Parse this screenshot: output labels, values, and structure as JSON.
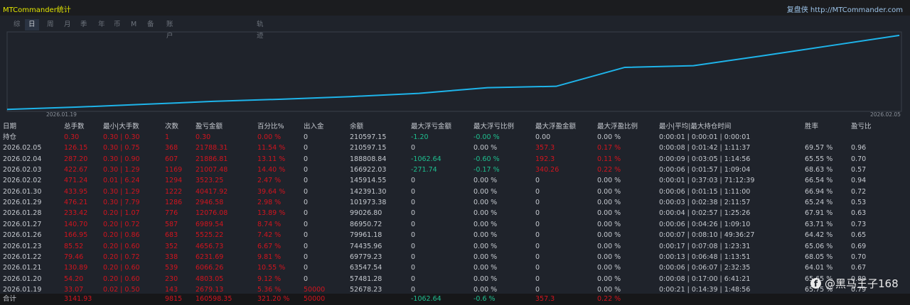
{
  "header": {
    "title": "MTCommander统计",
    "site": "复盘侠 http://MTCommander.com"
  },
  "tabs": [
    {
      "label": "综"
    },
    {
      "label": "日",
      "active": true
    },
    {
      "label": "周"
    },
    {
      "label": "月"
    },
    {
      "label": "季"
    },
    {
      "label": "年"
    },
    {
      "label": "币"
    },
    {
      "label": "M"
    },
    {
      "label": "备"
    },
    {
      "label": "账户"
    },
    {
      "label": "轨迹"
    }
  ],
  "chart_data": {
    "type": "line",
    "x": [
      "2026.01.19",
      "2026.01.20",
      "2026.01.21",
      "2026.01.22",
      "2026.01.23",
      "2026.01.26",
      "2026.01.27",
      "2026.01.28",
      "2026.01.29",
      "2026.01.30",
      "2026.02.02",
      "2026.02.03",
      "2026.02.04",
      "2026.02.05"
    ],
    "values": [
      52678.23,
      57481.28,
      63547.54,
      69779.23,
      74435.96,
      79961.18,
      86950.72,
      99026.8,
      101973.38,
      142391.3,
      145914.55,
      166922.03,
      188808.84,
      210597.15
    ],
    "tick_labels": [
      "2026.01.19",
      "2026.02.05"
    ],
    "color": "#1eb4ea",
    "ylim": [
      50000,
      215000
    ]
  },
  "table": {
    "columns": [
      "日期",
      "总手数",
      "最小|大手数",
      "次数",
      "盈亏金额",
      "百分比%",
      "出入金",
      "余额",
      "最大浮亏金额",
      "最大浮亏比例",
      "最大浮盈金额",
      "最大浮盈比例",
      "最小|平均|最大持仓时间",
      "胜率",
      "盈亏比"
    ],
    "rows": [
      [
        "持仓",
        "0.30",
        "0.30 | 0.30",
        "1",
        "0.30",
        "0.00 %",
        "0",
        "210597.15",
        "-1.20",
        "-0.00 %",
        "0.00",
        "0.00 %",
        "0:00:01 | 0:00:01 | 0:00:01",
        "",
        ""
      ],
      [
        "2026.02.05",
        "126.15",
        "0.30 | 0.75",
        "368",
        "21788.31",
        "11.54 %",
        "0",
        "210597.15",
        "0",
        "0.00 %",
        "357.3",
        "0.17 %",
        "0:00:08 | 0:01:42 | 1:11:37",
        "69.57 %",
        "0.96"
      ],
      [
        "2026.02.04",
        "287.20",
        "0.30 | 0.90",
        "607",
        "21886.81",
        "13.11 %",
        "0",
        "188808.84",
        "-1062.64",
        "-0.60 %",
        "192.3",
        "0.11 %",
        "0:00:09 | 0:03:05 | 1:14:56",
        "65.55 %",
        "0.70"
      ],
      [
        "2026.02.03",
        "422.67",
        "0.30 | 1.29",
        "1169",
        "21007.48",
        "14.40 %",
        "0",
        "166922.03",
        "-271.74",
        "-0.17 %",
        "340.26",
        "0.22 %",
        "0:00:06 | 0:01:57 | 1:09:04",
        "68.63 %",
        "0.57"
      ],
      [
        "2026.02.02",
        "471.24",
        "0.01 | 6.24",
        "1294",
        "3523.25",
        "2.47 %",
        "0",
        "145914.55",
        "0",
        "0.00 %",
        "0",
        "0.00 %",
        "0:00:01 | 0:37:03 | 71:12:39",
        "66.54 %",
        "0.94"
      ],
      [
        "2026.01.30",
        "433.95",
        "0.30 | 1.29",
        "1222",
        "40417.92",
        "39.64 %",
        "0",
        "142391.30",
        "0",
        "0.00 %",
        "0",
        "0.00 %",
        "0:00:06 | 0:01:15 | 1:11:00",
        "66.94 %",
        "0.72"
      ],
      [
        "2026.01.29",
        "476.21",
        "0.30 | 7.79",
        "1286",
        "2946.58",
        "2.98 %",
        "0",
        "101973.38",
        "0",
        "0.00 %",
        "0",
        "0.00 %",
        "0:00:03 | 0:02:38 | 2:11:57",
        "65.24 %",
        "0.53"
      ],
      [
        "2026.01.28",
        "233.42",
        "0.20 | 1.07",
        "776",
        "12076.08",
        "13.89 %",
        "0",
        "99026.80",
        "0",
        "0.00 %",
        "0",
        "0.00 %",
        "0:00:04 | 0:02:57 | 1:25:26",
        "67.91 %",
        "0.63"
      ],
      [
        "2026.01.27",
        "140.70",
        "0.20 | 0.72",
        "587",
        "6989.54",
        "8.74 %",
        "0",
        "86950.72",
        "0",
        "0.00 %",
        "0",
        "0.00 %",
        "0:00:06 | 0:04:26 | 1:09:10",
        "63.71 %",
        "0.73"
      ],
      [
        "2026.01.26",
        "166.95",
        "0.20 | 0.86",
        "683",
        "5525.22",
        "7.42 %",
        "0",
        "79961.18",
        "0",
        "0.00 %",
        "0",
        "0.00 %",
        "0:00:07 | 0:08:10 | 49:36:27",
        "64.42 %",
        "0.65"
      ],
      [
        "2026.01.23",
        "85.52",
        "0.20 | 0.60",
        "352",
        "4656.73",
        "6.67 %",
        "0",
        "74435.96",
        "0",
        "0.00 %",
        "0",
        "0.00 %",
        "0:00:17 | 0:07:08 | 1:23:31",
        "65.06 %",
        "0.69"
      ],
      [
        "2026.01.22",
        "79.46",
        "0.20 | 0.72",
        "338",
        "6231.69",
        "9.81 %",
        "0",
        "69779.23",
        "0",
        "0.00 %",
        "0",
        "0.00 %",
        "0:00:13 | 0:06:48 | 1:13:51",
        "68.05 %",
        "0.70"
      ],
      [
        "2026.01.21",
        "130.89",
        "0.20 | 0.60",
        "539",
        "6066.26",
        "10.55 %",
        "0",
        "63547.54",
        "0",
        "0.00 %",
        "0",
        "0.00 %",
        "0:00:06 | 0:06:07 | 2:32:35",
        "64.01 %",
        "0.67"
      ],
      [
        "2026.01.20",
        "54.20",
        "0.20 | 0.60",
        "230",
        "4803.05",
        "9.12 %",
        "0",
        "57481.28",
        "0",
        "0.00 %",
        "0",
        "0.00 %",
        "0:00:08 | 0:17:00 | 6:41:21",
        "65.65 %",
        "0.89"
      ],
      [
        "2026.01.19",
        "33.07",
        "0.02 | 0.50",
        "143",
        "2679.13",
        "5.36 %",
        "50000",
        "52678.23",
        "0",
        "0.00 %",
        "0",
        "0.00 %",
        "0:00:21 | 0:14:39 | 1:48:56",
        "65.75 %",
        "0.79"
      ]
    ],
    "totals": [
      "合计",
      "3141.93",
      "",
      "9815",
      "160598.35",
      "321.20 %",
      "50000",
      "",
      "-1062.64",
      "-0.6 %",
      "357.3",
      "0.22 %",
      "",
      "",
      ""
    ]
  },
  "watermark": {
    "text": "@黑马王子168",
    "icon": "facebook-icon"
  },
  "colors": {
    "profit": "#d2141e",
    "loss": "#1fbf8f",
    "title": "#e3e600"
  }
}
